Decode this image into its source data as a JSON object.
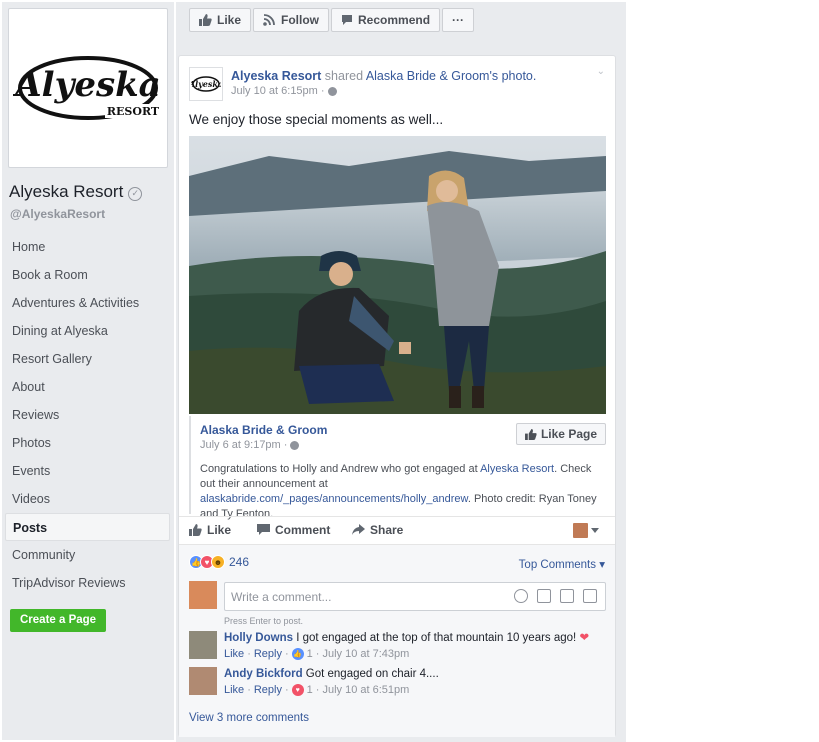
{
  "page": {
    "name": "Alyeska Resort",
    "handle": "@AlyeskaResort",
    "logo_text": "Alyeska",
    "logo_sub": "RESORT"
  },
  "nav": [
    {
      "label": "Home"
    },
    {
      "label": "Book a Room"
    },
    {
      "label": "Adventures & Activities"
    },
    {
      "label": "Dining at Alyeska"
    },
    {
      "label": "Resort Gallery"
    },
    {
      "label": "About"
    },
    {
      "label": "Reviews"
    },
    {
      "label": "Photos"
    },
    {
      "label": "Events"
    },
    {
      "label": "Videos"
    },
    {
      "label": "Posts",
      "active": true
    },
    {
      "label": "Community"
    },
    {
      "label": "TripAdvisor Reviews"
    }
  ],
  "create_page_label": "Create a Page",
  "action_bar": {
    "like": "Like",
    "follow": "Follow",
    "recommend": "Recommend",
    "more": "···"
  },
  "post": {
    "author": "Alyeska Resort",
    "shared_word": " shared ",
    "shared_source": "Alaska Bride & Groom",
    "shared_suffix": "'s photo.",
    "time": "July 10 at 6:15pm ·",
    "text": "We enjoy those special moments as well...",
    "shared": {
      "name": "Alaska Bride & Groom",
      "time": "July 6 at 9:17pm ·",
      "like_page": "Like Page",
      "text_1": "Congratulations to Holly and Andrew who got engaged at ",
      "text_link_1": "Alyeska Resort",
      "text_2": ". Check out their announcement at ",
      "text_link_2": "alaskabride.com/_pages/announcements/holly_andrew",
      "text_3": ". Photo credit: Ryan Toney and Ty Fenton."
    },
    "actions": {
      "like": "Like",
      "comment": "Comment",
      "share": "Share"
    },
    "reaction_count": "246",
    "top_comments": "Top Comments",
    "comment_placeholder": "Write a comment...",
    "press_enter": "Press Enter to post."
  },
  "comments": [
    {
      "author": "Holly Downs",
      "text": " I got engaged at the top of that mountain 10 years ago!",
      "like": "Like",
      "reply": "Reply",
      "reaction_count": "1",
      "time": "July 10 at 7:43pm"
    },
    {
      "author": "Andy Bickford",
      "text": " Got engaged on chair 4....",
      "like": "Like",
      "reply": "Reply",
      "reaction_count": "1",
      "time": "July 10 at 6:51pm"
    }
  ],
  "view_more": "View 3 more comments",
  "colors": {
    "fb_blue": "#365899",
    "green": "#42b72a",
    "background": "#e9ebee"
  }
}
